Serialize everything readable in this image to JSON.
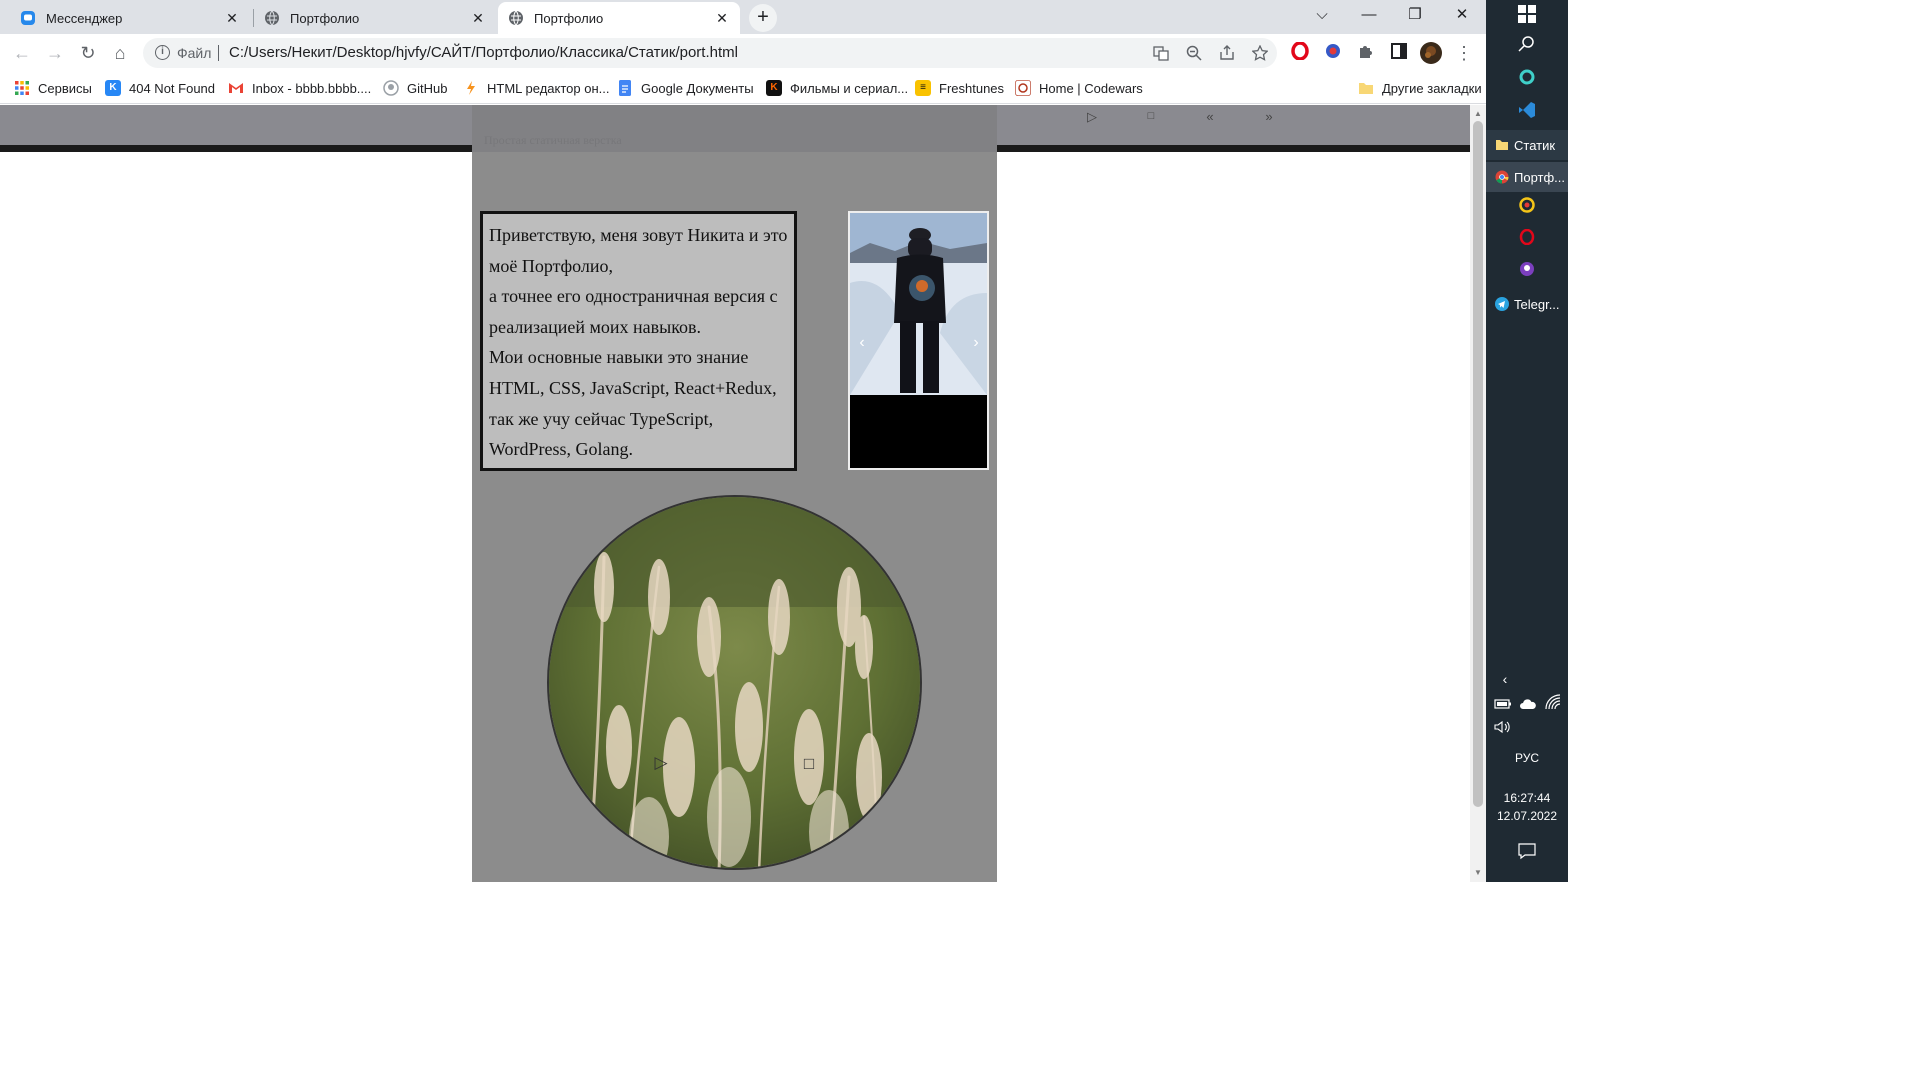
{
  "browser": {
    "tabs": [
      {
        "label": "Мессенджер",
        "active": false,
        "icon": "vk-messenger-icon"
      },
      {
        "label": "Портфолио",
        "active": false,
        "icon": "globe-icon"
      },
      {
        "label": "Портфолио",
        "active": true,
        "icon": "globe-icon"
      }
    ],
    "new_tab": "+",
    "window_controls": {
      "dropdown": "⌵",
      "minimize": "—",
      "restore": "❐",
      "close": "✕"
    },
    "nav": {
      "back": "←",
      "forward": "→",
      "reload": "↻",
      "home": "⌂"
    },
    "omnibox": {
      "scheme_label": "Файл",
      "url": "C:/Users/Некит/Desktop/hjvfy/САЙТ/Портфолио/Классика/Статик/port.html"
    },
    "bookmarks": [
      {
        "label": "Сервисы",
        "icon": "apps-grid-icon"
      },
      {
        "label": "404 Not Found",
        "icon": "vk-icon"
      },
      {
        "label": "Inbox - bbbb.bbbb....",
        "icon": "gmail-icon"
      },
      {
        "label": "GitHub",
        "icon": "github-icon"
      },
      {
        "label": "HTML редактор он...",
        "icon": "html-editor-icon"
      },
      {
        "label": "Google Документы",
        "icon": "google-docs-icon"
      },
      {
        "label": "Фильмы и сериал...",
        "icon": "kinopoisk-icon"
      },
      {
        "label": "Freshtunes",
        "icon": "freshtunes-icon"
      },
      {
        "label": "Home | Codewars",
        "icon": "codewars-icon"
      },
      {
        "label": "Другие закладки",
        "icon": "folder-icon"
      }
    ]
  },
  "page": {
    "subtitle": "Простая статичная верстка",
    "player_controls": [
      "▷",
      "□",
      "«",
      "»"
    ],
    "intro_lines": [
      "Приветствую, меня зовут Никита и это моё Портфолио,",
      "а точнее его одностраничная версия с реализацией моих навыков.",
      "Мои основные навыки это знание HTML, CSS, JavaScript, React+Redux, так же учу сейчас TypeScript, WordPress, Golang."
    ],
    "slider": {
      "prev": "‹",
      "next": "›"
    },
    "circle_controls": {
      "play": "▷",
      "stop": "□"
    }
  },
  "taskbar": {
    "items": [
      {
        "label": "Статик",
        "icon": "folder-icon"
      },
      {
        "label": "Портф...",
        "icon": "chrome-icon"
      },
      {
        "label": "Telegr...",
        "icon": "telegram-icon"
      }
    ],
    "language": "РУС",
    "time": "16:27:44",
    "date": "12.07.2022"
  },
  "colors": {
    "tab_bar": "#dee1e6",
    "page_container": "#8c8c8c",
    "intro_box": "#bdbdbd",
    "taskbar": "#1f2a33"
  }
}
